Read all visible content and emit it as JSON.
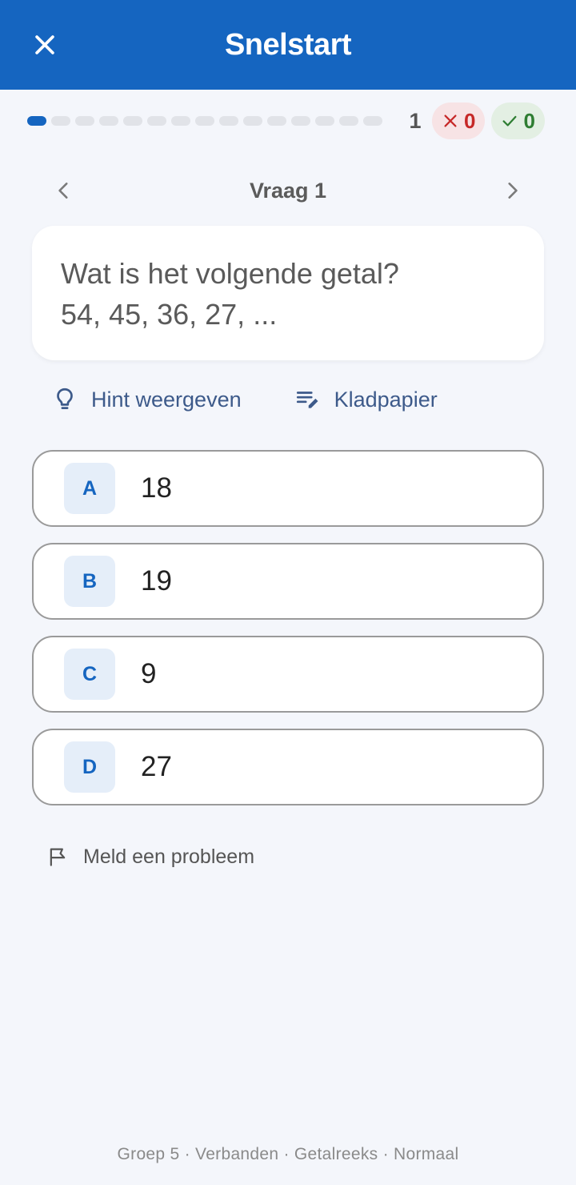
{
  "header": {
    "title": "Snelstart",
    "close_icon": "close-icon"
  },
  "progress": {
    "total_steps": 15,
    "current_step": 1,
    "question_number": "1",
    "wrong_count": "0",
    "right_count": "0",
    "colors": {
      "active": "#1565c0",
      "inactive": "#e1e3e8"
    }
  },
  "question_nav": {
    "title": "Vraag 1"
  },
  "question": {
    "line1": "Wat is het volgende getal?",
    "line2": "54, 45, 36, 27, ..."
  },
  "tools": {
    "hint_label": "Hint weergeven",
    "scratch_label": "Kladpapier"
  },
  "options": [
    {
      "letter": "A",
      "value": "18"
    },
    {
      "letter": "B",
      "value": "19"
    },
    {
      "letter": "C",
      "value": "9"
    },
    {
      "letter": "D",
      "value": "27"
    }
  ],
  "report": {
    "label": "Meld een probleem"
  },
  "footer": {
    "text": "Groep 5 · Verbanden · Getalreeks · Normaal"
  },
  "colors": {
    "brand": "#1565c0",
    "background": "#f4f6fb",
    "wrong": "#c62828",
    "right": "#2e7d32"
  }
}
